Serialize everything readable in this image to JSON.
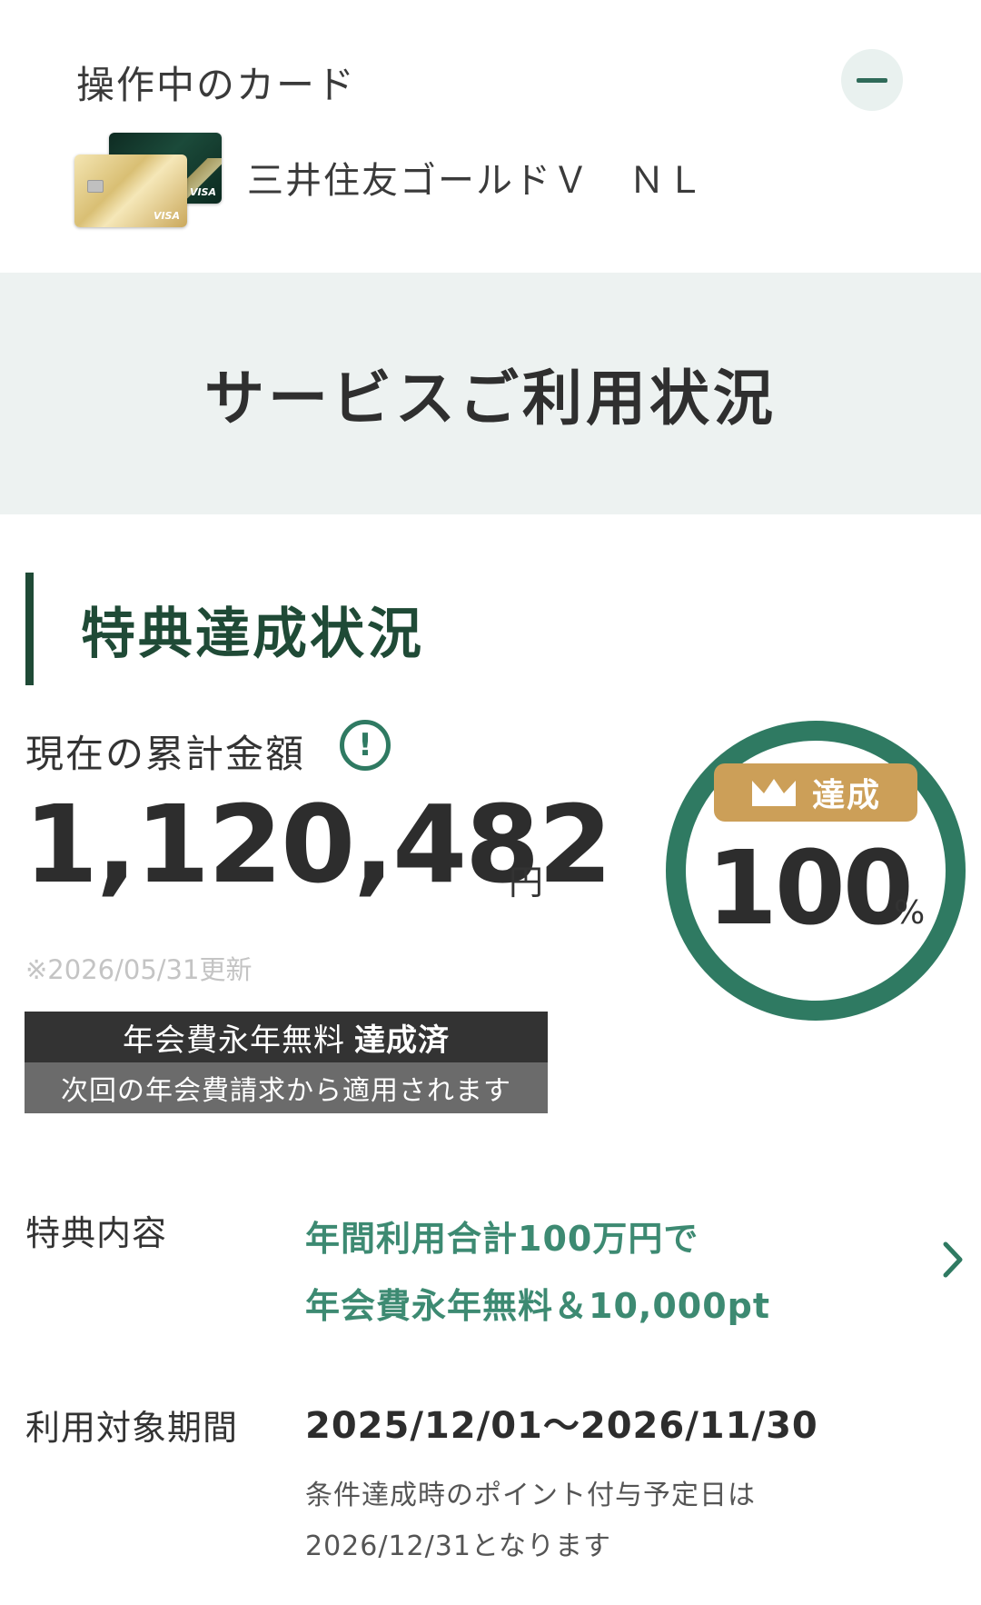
{
  "card_header": {
    "title": "操作中のカード",
    "card_name": "三井住友ゴールドＶ　ＮＬ"
  },
  "page_title": "サービスご利用状況",
  "section": {
    "title": "特典達成状況"
  },
  "cumulative": {
    "label": "現在の累計金額",
    "amount": "1,120,482",
    "unit": "円",
    "updated": "※2026/05/31更新"
  },
  "achievement_banner": {
    "main_prefix": "年会費永年無料",
    "main_status": "達成済",
    "sub": "次回の年会費請求から適用されます"
  },
  "progress": {
    "badge": "達成",
    "value": "100",
    "unit": "%",
    "fraction": 1.0,
    "ring_color": "#2f7a62",
    "badge_color": "#cc9f58"
  },
  "benefit": {
    "label": "特典内容",
    "line1": "年間利用合計100万円で",
    "line2": "年会費永年無料＆10,000pt"
  },
  "period": {
    "label": "利用対象期間",
    "value": "2025/12/01〜2026/11/30",
    "note1": "条件達成時のポイント付与予定日は",
    "note2": "2026/12/31となります"
  }
}
